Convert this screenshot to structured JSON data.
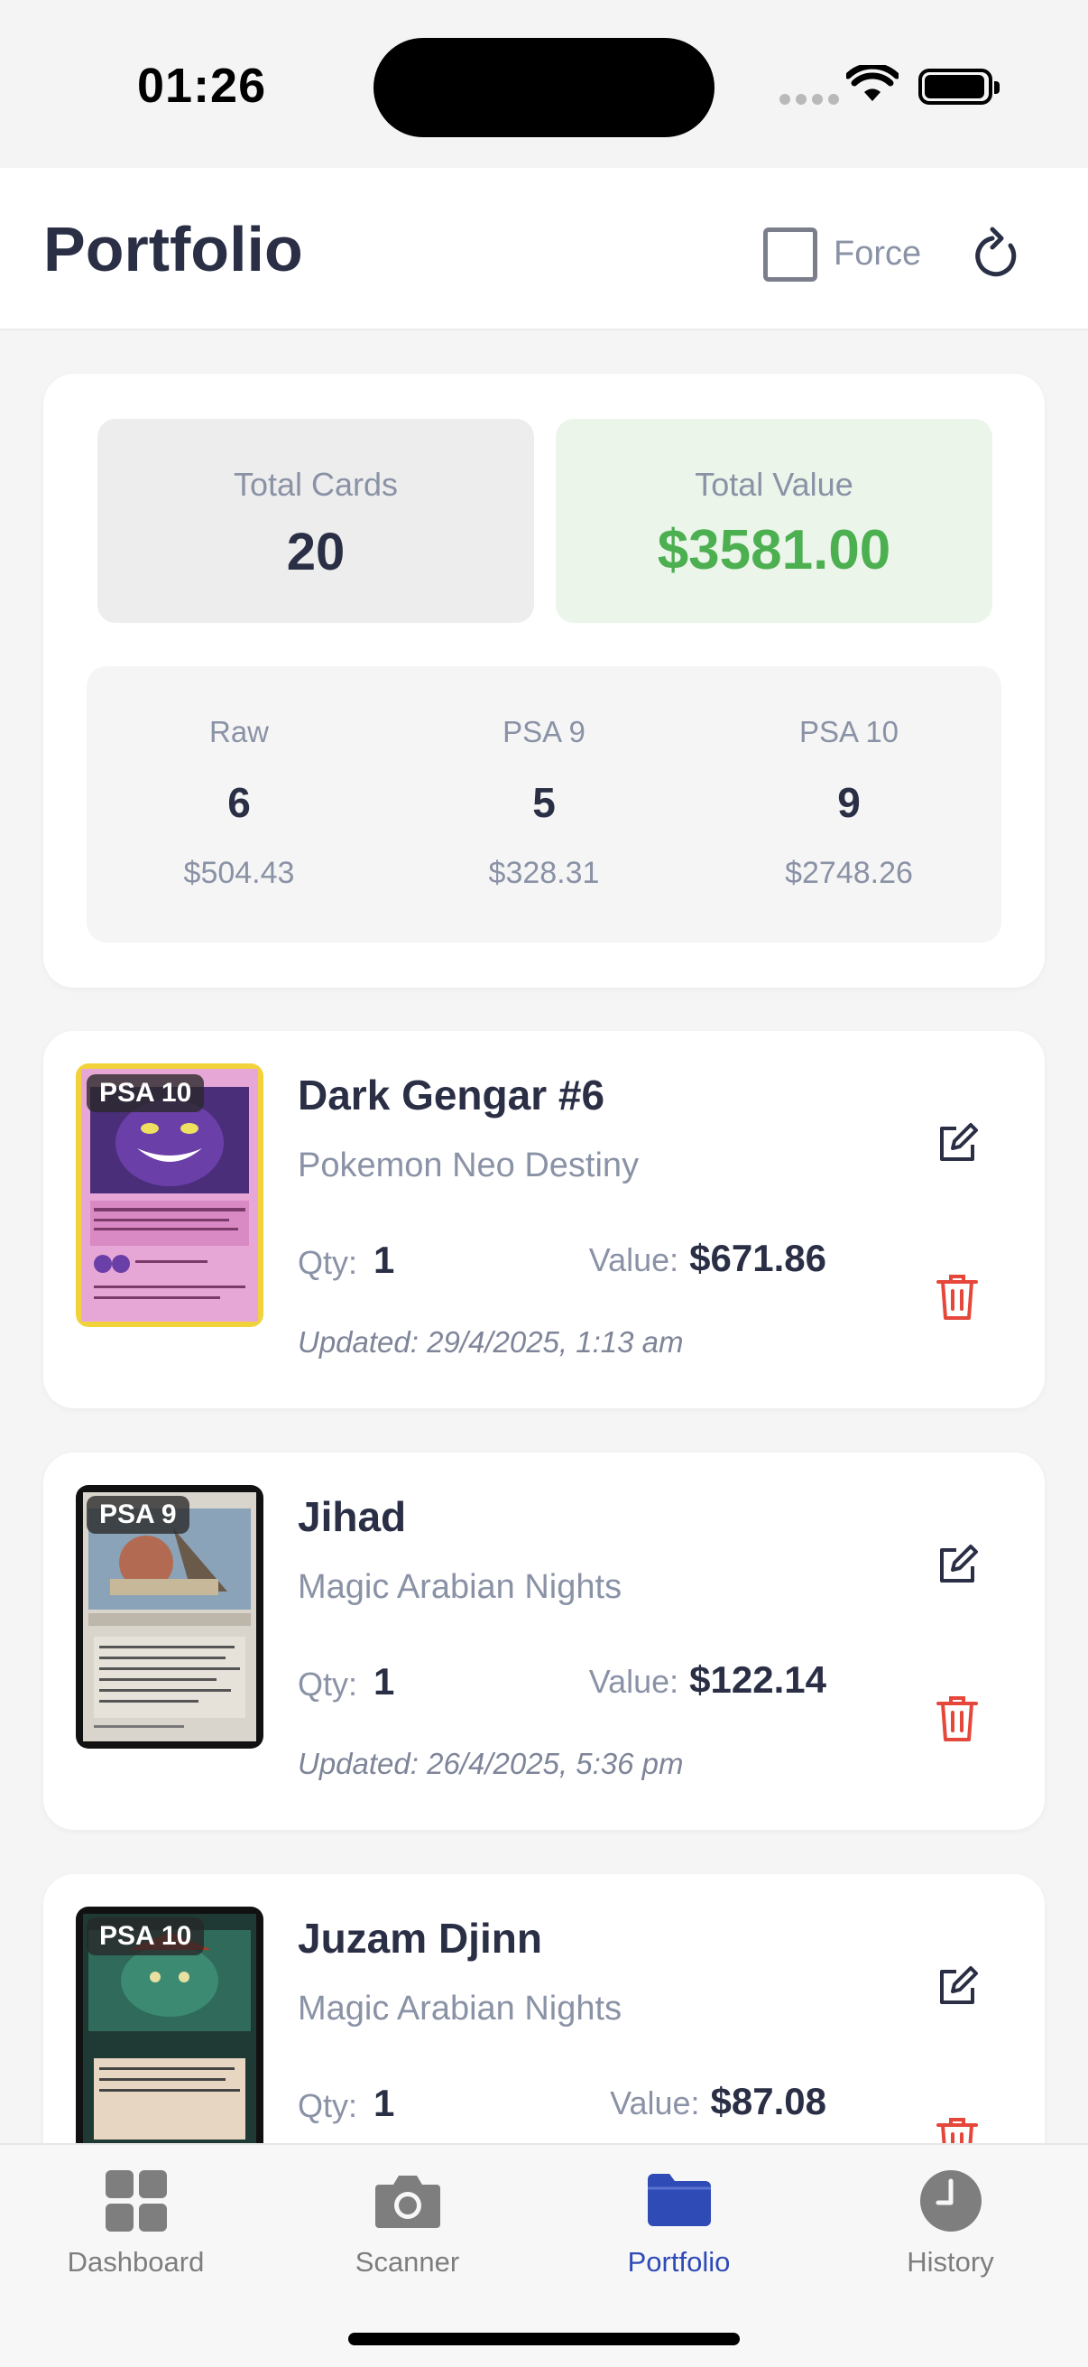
{
  "status_bar": {
    "time": "01:26"
  },
  "header": {
    "title": "Portfolio",
    "force_label": "Force"
  },
  "summary": {
    "total_cards_label": "Total Cards",
    "total_cards": "20",
    "total_value_label": "Total Value",
    "total_value": "$3581.00",
    "breakdown": [
      {
        "label": "Raw",
        "count": "6",
        "value": "$504.43"
      },
      {
        "label": "PSA 9",
        "count": "5",
        "value": "$328.31"
      },
      {
        "label": "PSA 10",
        "count": "9",
        "value": "$2748.26"
      }
    ]
  },
  "items": [
    {
      "grade": "PSA 10",
      "name": "Dark Gengar #6",
      "set": "Pokemon Neo Destiny",
      "qty_label": "Qty:",
      "qty": "1",
      "value_label": "Value:",
      "value": "$671.86",
      "updated": "Updated: 29/4/2025, 1:13 am"
    },
    {
      "grade": "PSA 9",
      "name": "Jihad",
      "set": "Magic Arabian Nights",
      "qty_label": "Qty:",
      "qty": "1",
      "value_label": "Value:",
      "value": "$122.14",
      "updated": "Updated: 26/4/2025, 5:36 pm"
    },
    {
      "grade": "PSA 10",
      "name": "Juzam Djinn",
      "set": "Magic Arabian Nights",
      "qty_label": "Qty:",
      "qty": "1",
      "value_label": "Value:",
      "value": "$87.08",
      "updated": ""
    }
  ],
  "tabs": [
    {
      "label": "Dashboard",
      "icon": "dashboard-icon"
    },
    {
      "label": "Scanner",
      "icon": "camera-icon"
    },
    {
      "label": "Portfolio",
      "icon": "folder-icon",
      "active": true
    },
    {
      "label": "History",
      "icon": "clock-icon"
    }
  ],
  "colors": {
    "accent": "#2f4bb5",
    "positive": "#4caf50",
    "danger": "#e5473b",
    "text": "#2a2f45",
    "muted": "#8a92a6"
  }
}
